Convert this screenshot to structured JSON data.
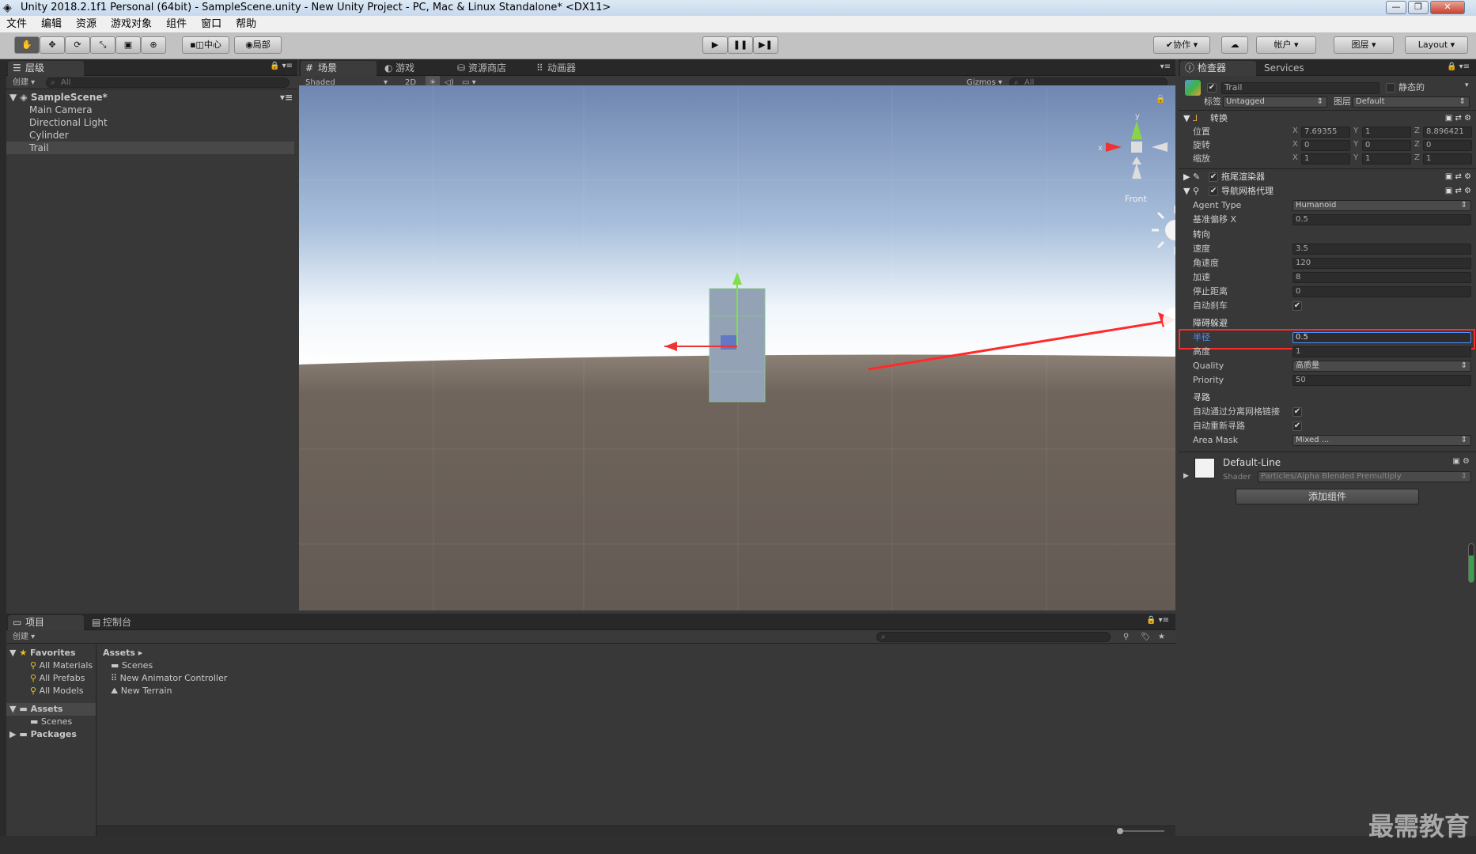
{
  "window": {
    "title": "Unity 2018.2.1f1 Personal (64bit) - SampleScene.unity - New Unity Project - PC, Mac & Linux Standalone* <DX11>",
    "min": "—",
    "max": "❐",
    "close": "✕"
  },
  "menu": [
    "文件",
    "编辑",
    "资源",
    "游戏对象",
    "组件",
    "窗口",
    "帮助"
  ],
  "toolbar": {
    "center": "中心",
    "local": "局部",
    "collab": "协作",
    "account": "帐户",
    "layers": "图层",
    "layout": "Layout"
  },
  "hierarchy": {
    "tab": "层级",
    "create": "创建",
    "search_placeholder": "All",
    "scene": "SampleScene*",
    "items": [
      "Main Camera",
      "Directional Light",
      "Cylinder",
      "Trail"
    ]
  },
  "scene": {
    "tabs": [
      "场景",
      "游戏",
      "资源商店",
      "动画器"
    ],
    "shading": "Shaded",
    "mode2d": "2D",
    "gizmos": "Gizmos",
    "search_placeholder": "All",
    "orientation": "Front",
    "axis_x": "x",
    "axis_y": "y"
  },
  "inspector": {
    "tab": "检查器",
    "services_tab": "Services",
    "object_name": "Trail",
    "static": "静态的",
    "tag_label": "标签",
    "tag": "Untagged",
    "layer_label": "图层",
    "layer": "Default",
    "transform": {
      "title": "转换",
      "position_label": "位置",
      "rotation_label": "旋转",
      "scale_label": "缩放",
      "position": [
        "7.69355",
        "1",
        "8.896421"
      ],
      "rotation": [
        "0",
        "0",
        "0"
      ],
      "scale": [
        "1",
        "1",
        "1"
      ]
    },
    "trail_renderer": "拖尾渲染器",
    "nav_agent": {
      "title": "导航网格代理",
      "agent_type_label": "Agent Type",
      "agent_type": "Humanoid",
      "base_offset_label": "基准偏移",
      "base_offset": "0.5",
      "steering_label": "转向",
      "speed_label": "速度",
      "speed": "3.5",
      "angular_label": "角速度",
      "angular": "120",
      "accel_label": "加速",
      "accel": "8",
      "stop_label": "停止距离",
      "stop": "0",
      "brake_label": "自动刹车",
      "obstacle_label": "障碍躲避",
      "radius_label": "半径",
      "radius": "0.5",
      "height_label": "高度",
      "height": "1",
      "quality_label": "Quality",
      "quality": "高质量",
      "priority_label": "Priority",
      "priority": "50",
      "path_label": "寻路",
      "auto_link_label": "自动通过分离网格链接",
      "auto_repath_label": "自动重新寻路",
      "area_label": "Area Mask",
      "area": "Mixed ..."
    },
    "material": {
      "name": "Default-Line",
      "shader_label": "Shader",
      "shader": "Particles/Alpha Blended Premultiply"
    },
    "add_component": "添加组件"
  },
  "project": {
    "tabs": [
      "项目",
      "控制台"
    ],
    "create": "创建",
    "favorites": "Favorites",
    "fav_items": [
      "All Materials",
      "All Prefabs",
      "All Models"
    ],
    "assets": "Assets",
    "asset_tree": [
      "Scenes"
    ],
    "packages": "Packages",
    "breadcrumb": "Assets",
    "files": [
      "Scenes",
      "New Animator Controller",
      "New Terrain"
    ]
  },
  "watermark": "最需教育",
  "colors": {
    "highlight": "#ff2a2a",
    "selected_text": "#4f8fff"
  }
}
